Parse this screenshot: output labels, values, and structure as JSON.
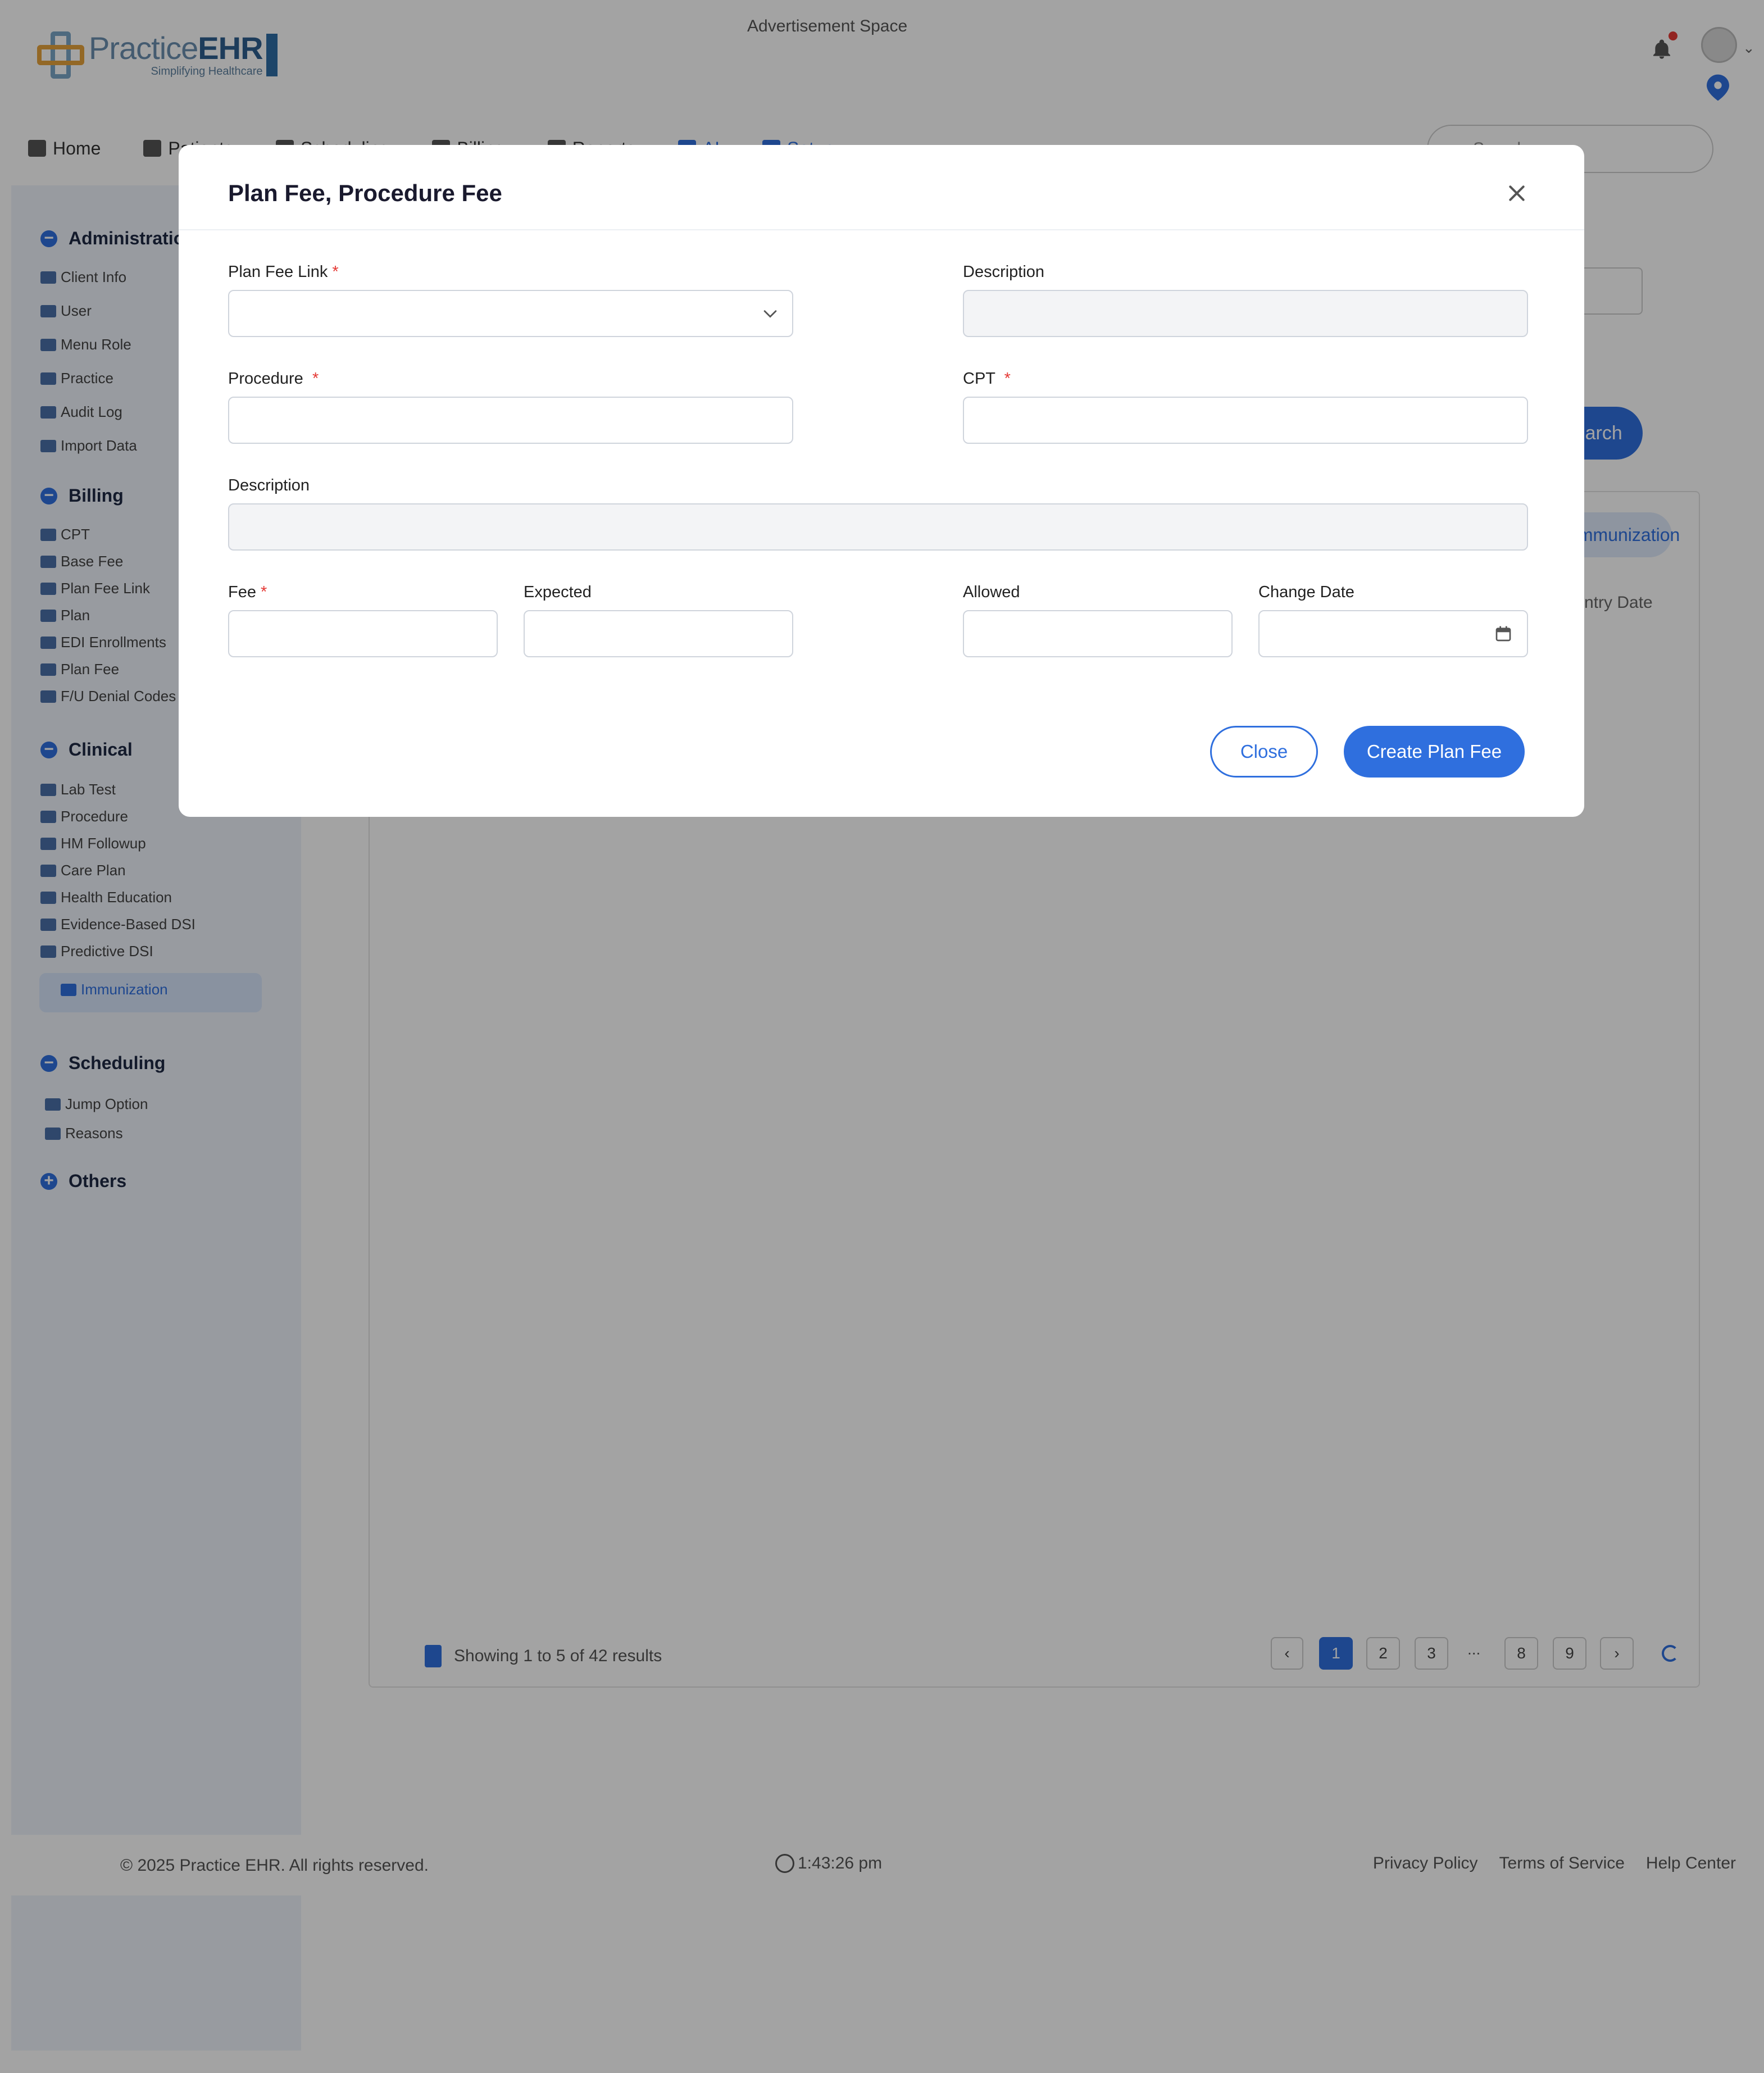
{
  "app": {
    "logo_main": "Practice",
    "logo_bold": "EHR",
    "logo_tagline": "Simplifying Healthcare",
    "ad_space": "Advertisement Space"
  },
  "nav": {
    "items": [
      {
        "label": "Home"
      },
      {
        "label": "Patients"
      },
      {
        "label": "Scheduling"
      },
      {
        "label": "Billing"
      },
      {
        "label": "Reports"
      },
      {
        "label": "AI"
      },
      {
        "label": "Setup"
      }
    ],
    "search_placeholder": "Search...",
    "accent_color": "#2f6fde"
  },
  "sidebar": {
    "groups": {
      "administration": "Administration",
      "billing": "Billing",
      "clinical": "Clinical",
      "scheduling": "Scheduling",
      "others": "Others"
    },
    "administration_items": [
      "Client Info",
      "User",
      "Menu Role",
      "Practice",
      "Audit Log",
      "Import Data"
    ],
    "billing_items": [
      "CPT",
      "Base Fee",
      "Plan Fee Link",
      "Plan",
      "EDI Enrollments",
      "Plan Fee",
      "F/U Denial Codes"
    ],
    "clinical_items": [
      "Lab Test",
      "Procedure",
      "HM Followup",
      "Care Plan",
      "Health Education",
      "Evidence-Based DSI",
      "Predictive DSI"
    ],
    "active_item": "Immunization",
    "scheduling_items": [
      "Jump Option",
      "Reasons"
    ]
  },
  "main": {
    "search_button": "Search",
    "pill": "Immunization",
    "column_entry_date": "Entry Date",
    "results_text": "Showing 1 to 5 of 42 results",
    "pages": [
      "1",
      "2",
      "3",
      "8",
      "9"
    ],
    "pages_ellipsis": "...",
    "current_page": "1"
  },
  "footer": {
    "copyright": "© 2025 Practice EHR. All rights reserved.",
    "time": "1:43:26 pm",
    "links": [
      "Privacy Policy",
      "Terms of Service",
      "Help Center"
    ]
  },
  "modal": {
    "title": "Plan Fee, Procedure Fee",
    "fields": {
      "plan_fee_link": {
        "label": "Plan Fee Link",
        "value": ""
      },
      "description_top": {
        "label": "Description",
        "value": ""
      },
      "procedure": {
        "label": "Procedure",
        "value": ""
      },
      "cpt": {
        "label": "CPT",
        "value": ""
      },
      "description_full": {
        "label": "Description",
        "value": ""
      },
      "fee": {
        "label": "Fee",
        "value": ""
      },
      "expected": {
        "label": "Expected",
        "value": ""
      },
      "allowed": {
        "label": "Allowed",
        "value": ""
      },
      "change_date": {
        "label": "Change Date",
        "value": ""
      }
    },
    "required_marker": "*",
    "close_label": "Close",
    "create_label": "Create Plan Fee"
  }
}
